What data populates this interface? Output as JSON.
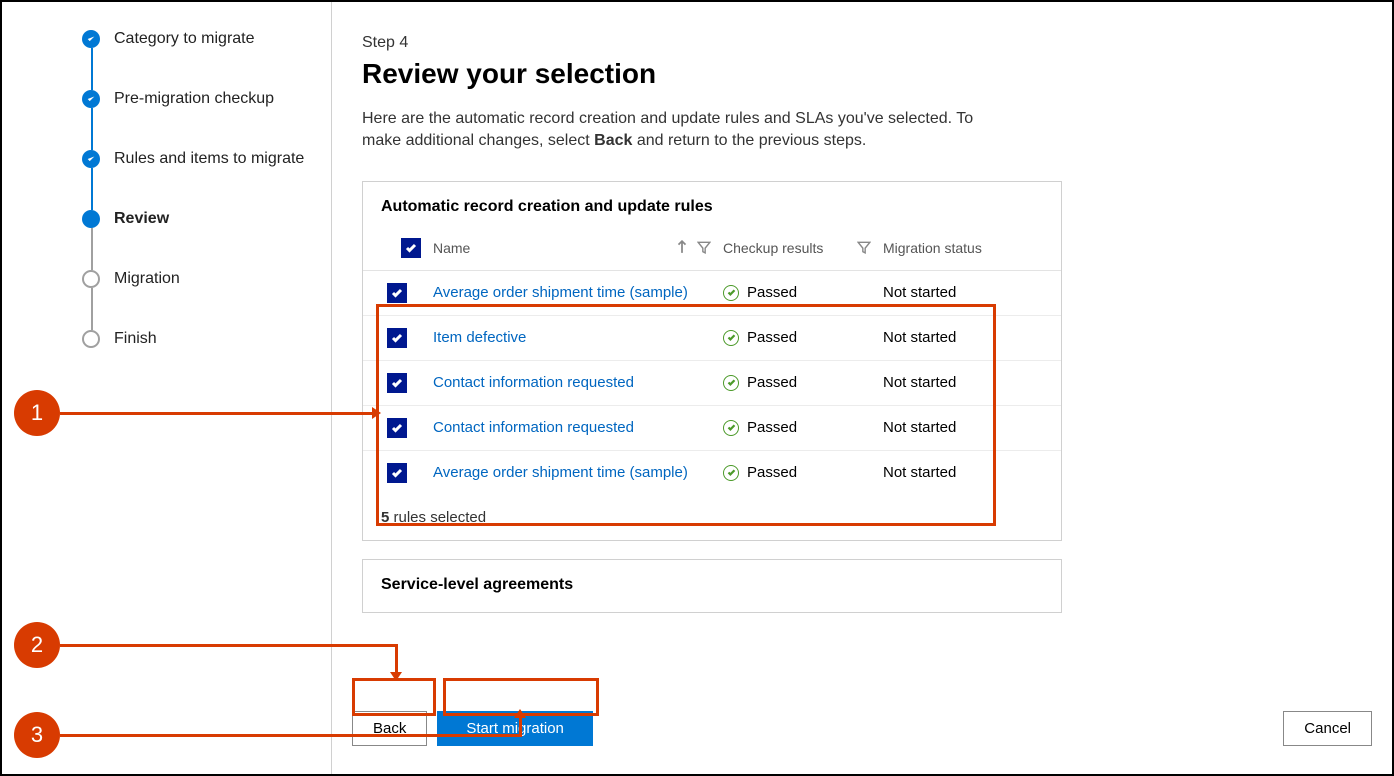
{
  "steps": [
    {
      "label": "Category to migrate",
      "state": "done"
    },
    {
      "label": "Pre-migration checkup",
      "state": "done"
    },
    {
      "label": "Rules and items to migrate",
      "state": "done"
    },
    {
      "label": "Review",
      "state": "current"
    },
    {
      "label": "Migration",
      "state": "todo"
    },
    {
      "label": "Finish",
      "state": "todo"
    }
  ],
  "header": {
    "step_num": "Step 4",
    "title": "Review your selection",
    "intro_pre": "Here are the automatic record creation and update rules and SLAs you've selected. To make additional changes, select ",
    "intro_bold": "Back",
    "intro_post": " and return to the previous steps."
  },
  "panel1": {
    "title": "Automatic record creation and update rules",
    "columns": {
      "name": "Name",
      "checkup": "Checkup results",
      "status": "Migration status"
    },
    "rows": [
      {
        "name": "Average order shipment time (sample)",
        "checkup": "Passed",
        "status": "Not started"
      },
      {
        "name": "Item defective",
        "checkup": "Passed",
        "status": "Not started"
      },
      {
        "name": "Contact information requested",
        "checkup": "Passed",
        "status": "Not started"
      },
      {
        "name": "Contact information requested",
        "checkup": "Passed",
        "status": "Not started"
      },
      {
        "name": "Average order shipment time (sample)",
        "checkup": "Passed",
        "status": "Not started"
      }
    ],
    "summary_count": "5",
    "summary_text": " rules selected"
  },
  "panel2": {
    "title": "Service-level agreements"
  },
  "buttons": {
    "back": "Back",
    "start": "Start migration",
    "cancel": "Cancel"
  },
  "callouts": {
    "c1": "1",
    "c2": "2",
    "c3": "3"
  }
}
